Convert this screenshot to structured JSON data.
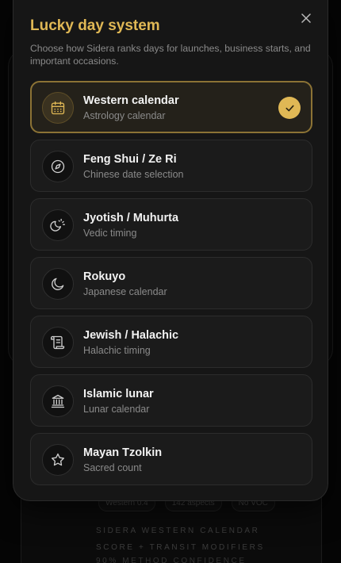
{
  "modal": {
    "title": "Lucky day system",
    "description": "Choose how Sidera ranks days for launches, business starts, and important occasions.",
    "options": [
      {
        "label": "Western calendar",
        "sub": "Astrology calendar",
        "icon": "calendar-icon",
        "selected": true
      },
      {
        "label": "Feng Shui / Ze Ri",
        "sub": "Chinese date selection",
        "icon": "compass-icon",
        "selected": false
      },
      {
        "label": "Jyotish / Muhurta",
        "sub": "Vedic timing",
        "icon": "sun-moon-icon",
        "selected": false
      },
      {
        "label": "Rokuyo",
        "sub": "Japanese calendar",
        "icon": "moon-icon",
        "selected": false
      },
      {
        "label": "Jewish / Halachic",
        "sub": "Halachic timing",
        "icon": "scroll-icon",
        "selected": false
      },
      {
        "label": "Islamic lunar",
        "sub": "Lunar calendar",
        "icon": "landmark-icon",
        "selected": false
      },
      {
        "label": "Mayan Tzolkin",
        "sub": "Sacred count",
        "icon": "star-icon",
        "selected": false
      }
    ]
  },
  "background": {
    "chips": [
      "Western 0.4",
      "142 aspects",
      "No VOC"
    ],
    "caption": "SIDERA WESTERN CALENDAR SCORE + TRANSIT MODIFIERS",
    "caption2": "90% METHOD CONFIDENCE"
  },
  "colors": {
    "accent": "#e0b855",
    "modal_bg": "#161616",
    "selected_border": "#8c7335"
  }
}
